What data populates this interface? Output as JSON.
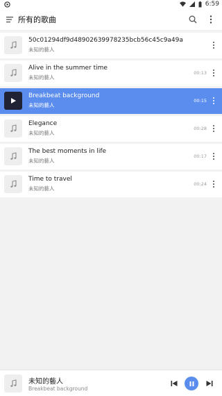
{
  "status": {
    "time": "6:59"
  },
  "toolbar": {
    "title": "所有的歌曲"
  },
  "songs": [
    {
      "title": "50c01294df9d48902639978235bcb56c45c9a49a",
      "artist": "未知的藝人",
      "duration": ""
    },
    {
      "title": "Alive in the summer time",
      "artist": "未知的藝人",
      "duration": "00:13"
    },
    {
      "title": "Breakbeat background",
      "artist": "未知的藝人",
      "duration": "00:15",
      "active": true
    },
    {
      "title": "Elegance",
      "artist": "未知的藝人",
      "duration": "00:28"
    },
    {
      "title": "The best moments in life",
      "artist": "未知的藝人",
      "duration": "00:17"
    },
    {
      "title": "Time to travel",
      "artist": "未知的藝人",
      "duration": "00:24"
    }
  ],
  "player": {
    "artist": "未知的藝人",
    "track": "Breakbeat background"
  },
  "colors": {
    "accent": "#5b8def",
    "background": "#f2f2f2",
    "active_thumb": "#1f2333"
  },
  "icons": {
    "menu": "menu-icon",
    "search": "search-icon",
    "more": "more-vert-icon",
    "note": "music-note-icon",
    "play": "play-icon",
    "pause": "pause-icon",
    "prev": "skip-previous-icon",
    "next": "skip-next-icon"
  }
}
